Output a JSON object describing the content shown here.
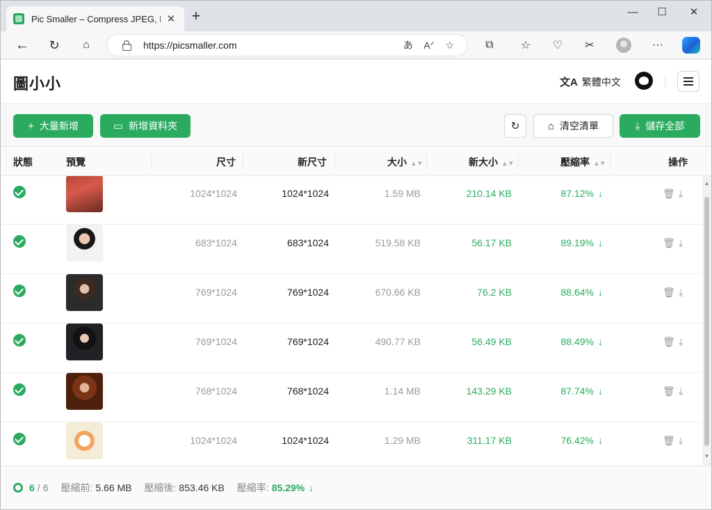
{
  "browser": {
    "tab_title": "Pic Smaller – Compress JPEG, PN",
    "tab_close": "✕",
    "new_tab": "+",
    "url": "https://picsmaller.com",
    "read_aloud": "A̅",
    "translate": "あ"
  },
  "app": {
    "logo": "圖小小",
    "language": "繁體中文",
    "language_icon": "文A"
  },
  "actions": {
    "batch_add": "大量新增",
    "add_folder": "新增資料夾",
    "clear_list": "清空清單",
    "save_all": "儲存全部"
  },
  "table": {
    "headers": {
      "status": "狀態",
      "preview": "預覽",
      "dimension": "尺寸",
      "new_dimension": "新尺寸",
      "size": "大小",
      "new_size": "新大小",
      "ratio": "壓縮率",
      "operation": "操作"
    },
    "rows": [
      {
        "dimension": "1024*1024",
        "new_dimension": "1024*1024",
        "size": "1.59 MB",
        "new_size": "210.14 KB",
        "ratio": "87.12%"
      },
      {
        "dimension": "683*1024",
        "new_dimension": "683*1024",
        "size": "519.58 KB",
        "new_size": "56.17 KB",
        "ratio": "89.19%"
      },
      {
        "dimension": "769*1024",
        "new_dimension": "769*1024",
        "size": "670.66 KB",
        "new_size": "76.2 KB",
        "ratio": "88.64%"
      },
      {
        "dimension": "769*1024",
        "new_dimension": "769*1024",
        "size": "490.77 KB",
        "new_size": "56.49 KB",
        "ratio": "88.49%"
      },
      {
        "dimension": "768*1024",
        "new_dimension": "768*1024",
        "size": "1.14 MB",
        "new_size": "143.29 KB",
        "ratio": "87.74%"
      },
      {
        "dimension": "1024*1024",
        "new_dimension": "1024*1024",
        "size": "1.29 MB",
        "new_size": "311.17 KB",
        "ratio": "76.42%"
      }
    ]
  },
  "footer": {
    "done": "6",
    "separator": "/",
    "total": "6",
    "before_label": "壓縮前:",
    "before_value": "5.66 MB",
    "after_label": "壓縮後:",
    "after_value": "853.46 KB",
    "ratio_label": "壓縮率:",
    "ratio_value": "85.29%"
  },
  "colors": {
    "accent": "#2bab60",
    "dim_text": "#999999"
  }
}
